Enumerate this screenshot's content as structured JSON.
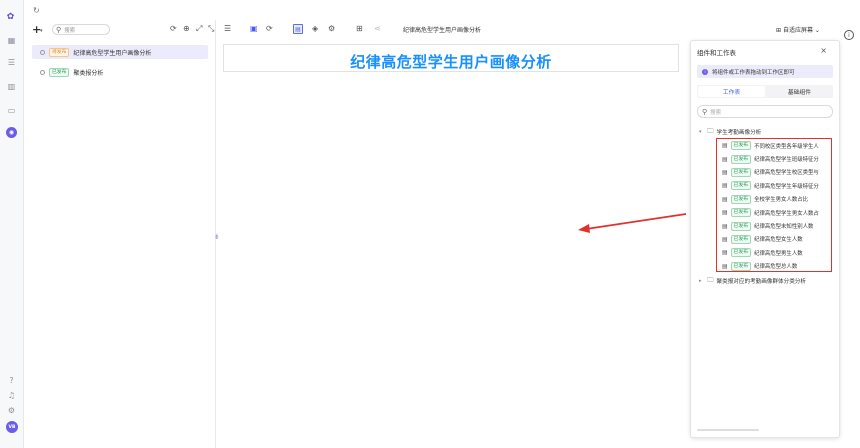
{
  "left_panel": {
    "search_placeholder": "搜索",
    "items": [
      {
        "badge": "待发布",
        "label": "纪律高危型学生用户画像分析"
      },
      {
        "badge": "已发布",
        "label": "聚类报分析"
      }
    ]
  },
  "toolbar": {
    "title": "纪律高危型学生用户画像分析",
    "layout_label": "自适应屏幕"
  },
  "canvas": {
    "title": "纪律高危型学生用户画像分析"
  },
  "right_panel": {
    "title": "组件和工作表",
    "tip": "将组件或工作表拖动到工作区即可",
    "tabs": [
      "工作表",
      "基础组件"
    ],
    "search_placeholder": "搜索",
    "folder1": "学生考勤画像分析",
    "items": [
      {
        "badge": "已发布",
        "label": "不同校区类型各年级学生人"
      },
      {
        "badge": "已发布",
        "label": "纪律高危型学生班级特征分"
      },
      {
        "badge": "已发布",
        "label": "纪律高危型学生校区类型与"
      },
      {
        "badge": "已发布",
        "label": "纪律高危型学生年级特征分"
      },
      {
        "badge": "已发布",
        "label": "全校学生男女人数占比"
      },
      {
        "badge": "已发布",
        "label": "纪律高危型学生男女人数占"
      },
      {
        "badge": "已发布",
        "label": "纪律高危型未知性别人数"
      },
      {
        "badge": "已发布",
        "label": "纪律高危型女生人数"
      },
      {
        "badge": "已发布",
        "label": "纪律高危型男生人数"
      },
      {
        "badge": "已发布",
        "label": "纪律高危型总人数"
      }
    ],
    "folder2": "聚类报对应的考勤画像群体分类分析"
  },
  "rail": {
    "avatar": "VB"
  },
  "colors": {
    "accent": "#6c5ce7",
    "title_blue": "#1890ff",
    "highlight_red": "#e03131"
  }
}
